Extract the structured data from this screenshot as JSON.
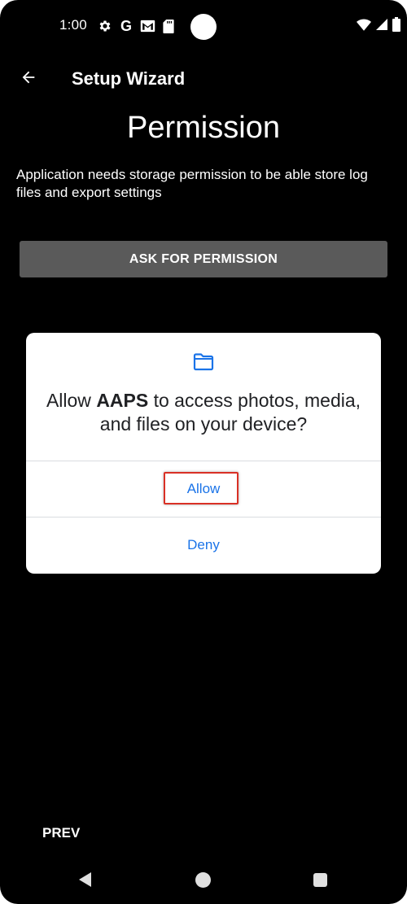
{
  "status_bar": {
    "time": "1:00",
    "left_icons": [
      "gear-icon",
      "google-icon",
      "gmail-icon",
      "sd-card-icon"
    ],
    "google_letter": "G",
    "right_icons": [
      "wifi-icon",
      "cellular-signal-icon",
      "battery-icon"
    ]
  },
  "app_bar": {
    "back_icon": "arrow-back-icon",
    "title": "Setup Wizard"
  },
  "page": {
    "title": "Permission",
    "description": "Application needs storage permission to be able store log files and export settings",
    "ask_button_label": "ASK FOR PERMISSION"
  },
  "dialog": {
    "icon": "folder-icon",
    "message_prefix": "Allow ",
    "app_name": "AAPS",
    "message_suffix": " to access photos, media, and files on your device?",
    "allow_label": "Allow",
    "deny_label": "Deny"
  },
  "footer": {
    "prev_label": "PREV"
  },
  "nav_bar": {
    "icons": [
      "nav-back-icon",
      "nav-home-icon",
      "nav-recents-icon"
    ]
  },
  "colors": {
    "background": "#000000",
    "dialog_background": "#ffffff",
    "dialog_button_text": "#1a73e8",
    "ask_button_background": "#5a5a5a",
    "highlight_border": "#d93025"
  }
}
